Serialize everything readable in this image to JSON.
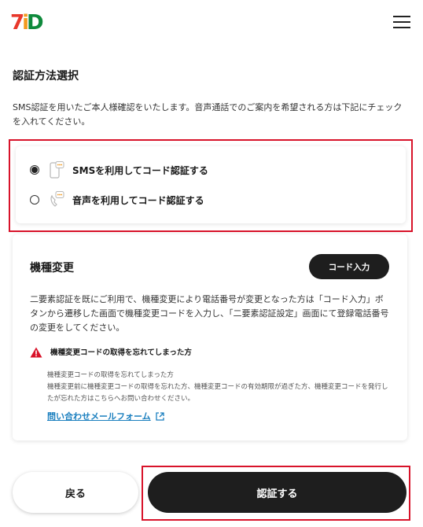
{
  "header": {
    "logo_text": "7iD",
    "menu_icon": "hamburger-menu-icon"
  },
  "page": {
    "title": "認証方法選択",
    "description": "SMS認証を用いたご本人様確認をいたします。音声通話でのご案内を希望される方は下記にチェックを入れてください。"
  },
  "options": [
    {
      "label": "SMSを利用してコード認証する",
      "checked": true,
      "icon": "sms-phone-icon"
    },
    {
      "label": "音声を利用してコード認証する",
      "checked": false,
      "icon": "voice-call-icon"
    }
  ],
  "device_change": {
    "title": "機種変更",
    "button_label": "コード入力",
    "body": "二要素認証を既にご利用で、機種変更により電話番号が変更となった方は「コード入力」ボタンから遷移した画面で機種変更コードを入力し、「二要素認証設定」画面にて登録電話番号の変更をしてください。",
    "warning_label": "機種変更コードの取得を忘れてしまった方",
    "warning_icon": "warning-triangle-icon",
    "detail_lines": [
      "機種変更コードの取得を忘れてしまった方",
      "機種変更前に機種変更コードの取得を忘れた方、機種変更コードの有効期限が過ぎた方、機種変更コードを発行したが忘れた方はこちらへお問い合わせください。"
    ],
    "contact_link": "問い合わせメールフォーム",
    "contact_icon": "external-link-icon"
  },
  "actions": {
    "back_label": "戻る",
    "submit_label": "認証する"
  },
  "colors": {
    "brand_red": "#e8382b",
    "brand_orange": "#f39a1e",
    "brand_green": "#0f8a3c",
    "highlight": "#d8132a",
    "link": "#1a7fbf",
    "button_dark": "#1e1e1e"
  }
}
